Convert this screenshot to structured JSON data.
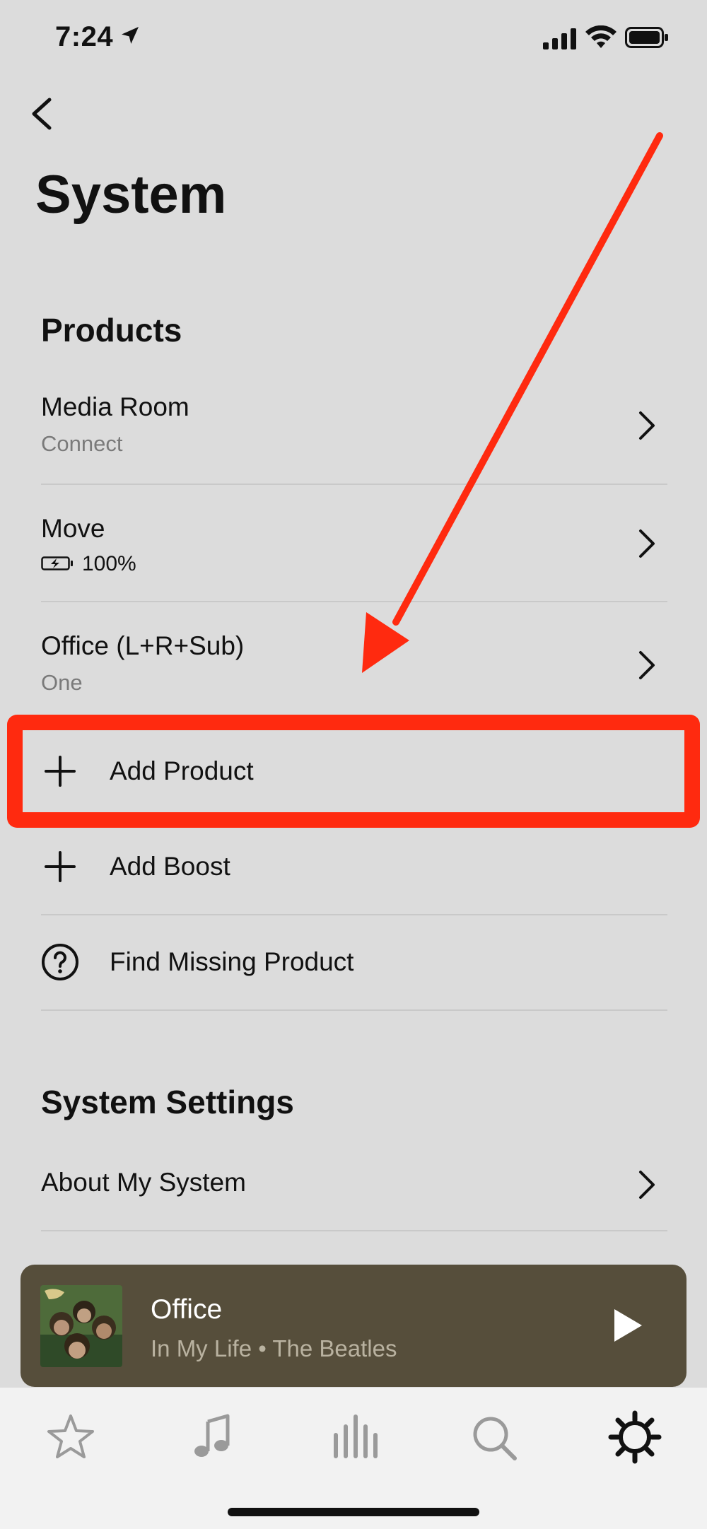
{
  "status_bar": {
    "time": "7:24",
    "icons": [
      "location-arrow-icon",
      "cellular-signal-icon",
      "wifi-icon",
      "battery-icon"
    ]
  },
  "header": {
    "back_icon": "chevron-left-icon",
    "title": "System"
  },
  "products": {
    "section_title": "Products",
    "items": [
      {
        "title": "Media Room",
        "subtitle": "Connect"
      },
      {
        "title": "Move",
        "battery_level": "100%"
      },
      {
        "title": "Office (L+R+Sub)",
        "subtitle": "One"
      }
    ],
    "actions": [
      {
        "label": "Add Product",
        "icon": "plus-icon"
      },
      {
        "label": "Add Boost",
        "icon": "plus-icon"
      },
      {
        "label": "Find Missing Product",
        "icon": "question-circle-icon"
      }
    ]
  },
  "system_settings": {
    "section_title": "System Settings",
    "items": [
      {
        "title": "About My System"
      }
    ]
  },
  "now_playing": {
    "room": "Office",
    "track": "In My Life • The Beatles",
    "background": "#564e3b"
  },
  "tab_bar": {
    "tabs": [
      "star-icon",
      "music-note-icon",
      "rooms-bars-icon",
      "search-icon",
      "settings-gear-icon"
    ],
    "active_tab": "settings-gear-icon"
  },
  "annotation": {
    "color": "#ff2a0f",
    "highlighted_item": "Add Product"
  }
}
